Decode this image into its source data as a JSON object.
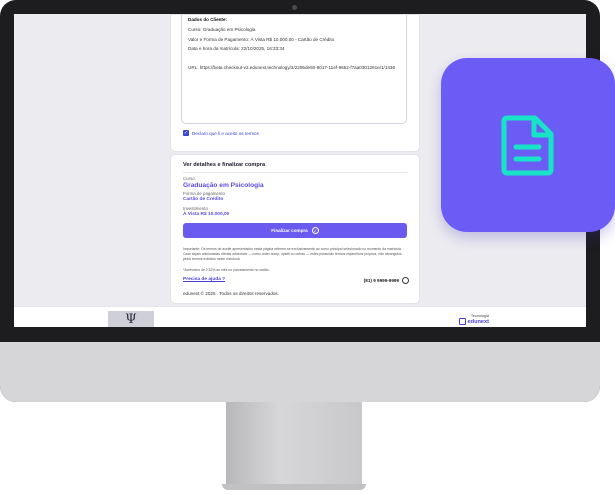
{
  "terms": {
    "heading": "Dados do Cliente:",
    "course_line": "Curso: Graduação em Psicologia",
    "payment_line": "Valor e Forma de Pagamento: À Vista R$ 10.000,00 - Cartão de Crédito",
    "datetime_line": "Data e hora da matrícula: 22/10/2025, 16:33:34",
    "url_line": "URL: https://beta.checkout-v2.edunext.technology/3/2295de50-8017-11ef-9652-f7aa0301291e/1/1436",
    "checkbox_label": "Declaro que li e aceito os termos"
  },
  "summary": {
    "title": "Ver detalhes e finalizar compra",
    "course_label": "Curso",
    "course_value": "Graduação em Psicologia",
    "payment_label": "Forma de pagamento",
    "payment_value": "Cartão de Crédito",
    "investment_label": "Investimento",
    "investment_value": "À Vista R$ 10.000,00",
    "finalize_button": "Finalizar compra",
    "disclaimer": "Importante: Os termos de aceite apresentados nesta página referem-se exclusivamente ao curso principal selecionado no momento da matrícula. Caso sejam adicionadas ofertas adicionais — como order bump, upsell ou outras — estes possuirão termos específicos próprios, não abrangidos pelos termos exibidos neste checkout.",
    "note": "*Acréscimo de 2,52% ao mês no parcelamento no cartão.",
    "help_link": "Precisa de ajuda ?",
    "phone": "(81) 9 9999-9999",
    "copyright": "edunext © 2025 . Todos os direitos reservados."
  },
  "footer": {
    "logo_glyph": "Ψ",
    "tech_label": "Tecnologia",
    "brand": "edunext"
  },
  "icons": {
    "checkbox": "check-icon",
    "finalize": "check-circle-icon",
    "phone": "whatsapp-icon",
    "badge": "document-icon"
  },
  "colors": {
    "accent": "#6a5af0",
    "link": "#4b3fd0",
    "badge": "#6b5cf6",
    "badge_icon": "#17e3c6"
  }
}
